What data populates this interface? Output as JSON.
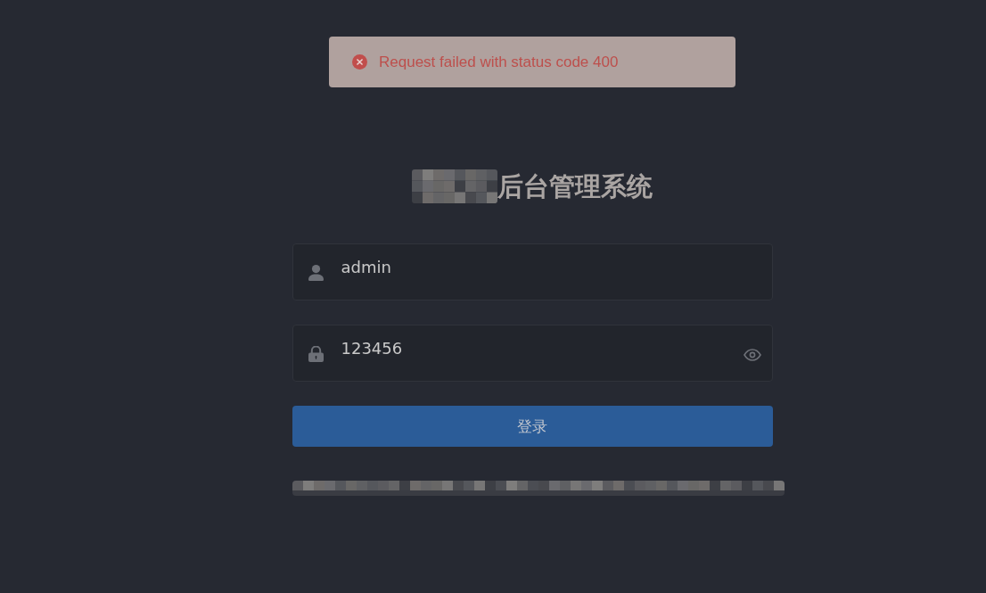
{
  "message": {
    "kind": "error",
    "text": "Request failed with status code 400"
  },
  "title": {
    "text": "后台管理系统"
  },
  "form": {
    "fields": [
      {
        "kind": "username",
        "value": "admin"
      },
      {
        "kind": "password",
        "value": "123456",
        "revealed": true
      }
    ],
    "submit": {
      "label": "登录"
    }
  }
}
